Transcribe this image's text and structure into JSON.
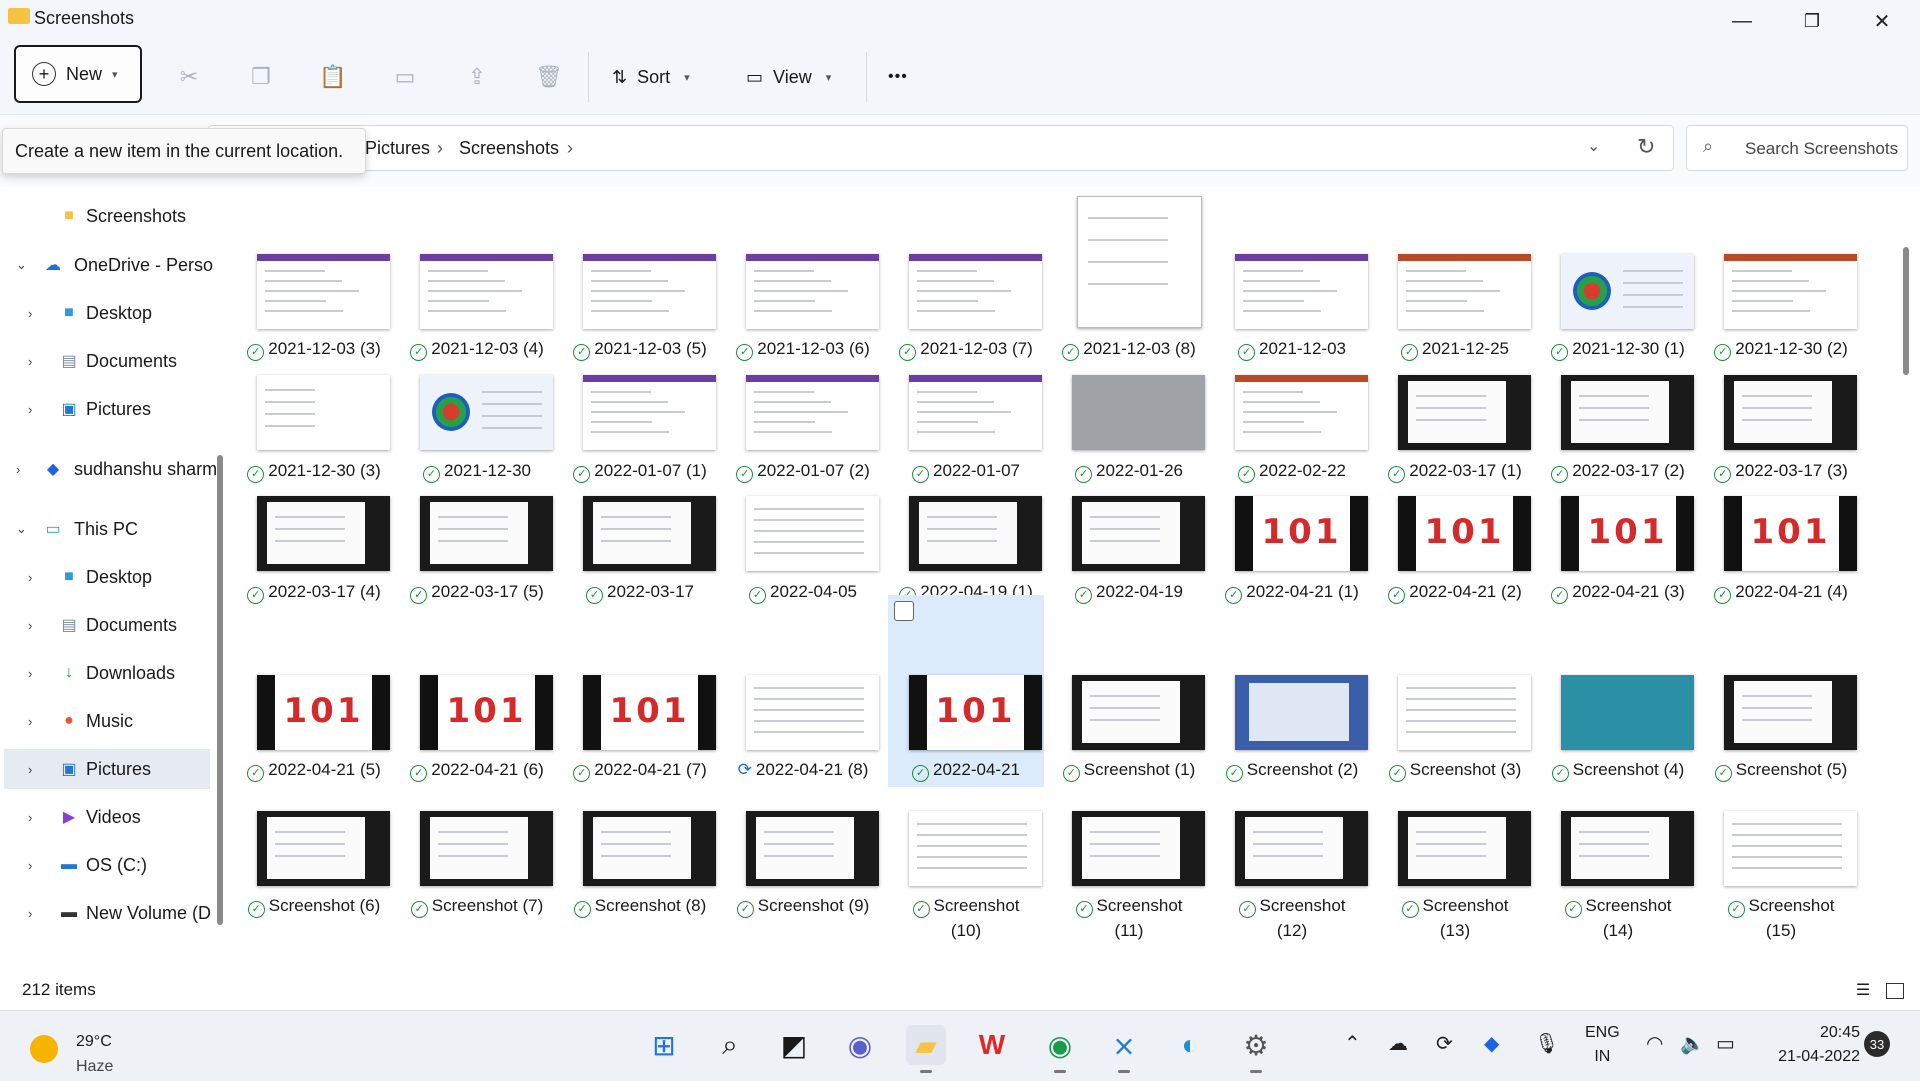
{
  "window": {
    "title": "Screenshots",
    "minimize": "—",
    "maximize": "❐",
    "close": "✕"
  },
  "toolbar": {
    "new_label": "New",
    "sort_label": "Sort",
    "view_label": "View",
    "more": "•••"
  },
  "tooltip": "Create a new item in the current location.",
  "address": {
    "crumbs": [
      "Pictures",
      "Screenshots"
    ],
    "separator": "›"
  },
  "search": {
    "placeholder": "Search Screenshots"
  },
  "nav": {
    "items": [
      {
        "label": "Screenshots",
        "icon": "folder-icon"
      },
      {
        "label": "OneDrive - Perso",
        "icon": "onedrive-icon"
      },
      {
        "label": "Desktop",
        "icon": "desktop-icon"
      },
      {
        "label": "Documents",
        "icon": "documents-icon"
      },
      {
        "label": "Pictures",
        "icon": "pictures-icon"
      },
      {
        "label": "sudhanshu sharm",
        "icon": "dropbox-icon"
      },
      {
        "label": "This PC",
        "icon": "pc-icon"
      },
      {
        "label": "Desktop",
        "icon": "desktop-icon"
      },
      {
        "label": "Documents",
        "icon": "documents-icon"
      },
      {
        "label": "Downloads",
        "icon": "downloads-icon"
      },
      {
        "label": "Music",
        "icon": "music-icon"
      },
      {
        "label": "Pictures",
        "icon": "pictures-icon"
      },
      {
        "label": "Videos",
        "icon": "videos-icon"
      },
      {
        "label": "OS (C:)",
        "icon": "drive-icon"
      },
      {
        "label": "New Volume (D",
        "icon": "drive-icon"
      }
    ]
  },
  "files": {
    "row1": [
      "2021-12-03 (3)",
      "2021-12-03 (4)",
      "2021-12-03 (5)",
      "2021-12-03 (6)",
      "2021-12-03 (7)",
      "2021-12-03 (8)",
      "2021-12-03",
      "2021-12-25",
      "2021-12-30 (1)",
      "2021-12-30 (2)"
    ],
    "row2": [
      "2021-12-30 (3)",
      "2021-12-30",
      "2022-01-07 (1)",
      "2022-01-07 (2)",
      "2022-01-07",
      "2022-01-26",
      "2022-02-22",
      "2022-03-17 (1)",
      "2022-03-17 (2)",
      "2022-03-17 (3)"
    ],
    "row3": [
      "2022-03-17 (4)",
      "2022-03-17 (5)",
      "2022-03-17",
      "2022-04-05",
      "2022-04-19 (1)",
      "2022-04-19",
      "2022-04-21 (1)",
      "2022-04-21 (2)",
      "2022-04-21 (3)",
      "2022-04-21 (4)"
    ],
    "row4": [
      "2022-04-21 (5)",
      "2022-04-21 (6)",
      "2022-04-21 (7)",
      "2022-04-21 (8)",
      "2022-04-21",
      "Screenshot (1)",
      "Screenshot (2)",
      "Screenshot (3)",
      "Screenshot (4)",
      "Screenshot (5)"
    ],
    "row5": [
      "Screenshot (6)",
      "Screenshot (7)",
      "Screenshot (8)",
      "Screenshot (9)",
      "Screenshot\n(10)",
      "Screenshot\n(11)",
      "Screenshot\n(12)",
      "Screenshot\n(13)",
      "Screenshot\n(14)",
      "Screenshot\n(15)"
    ],
    "logo_text": "101"
  },
  "status": {
    "item_count": "212 items"
  },
  "taskbar": {
    "weather_temp": "29°C",
    "weather_desc": "Haze",
    "lang_top": "ENG",
    "lang_bottom": "IN",
    "time": "20:45",
    "date": "21-04-2022",
    "notifications": "33"
  }
}
